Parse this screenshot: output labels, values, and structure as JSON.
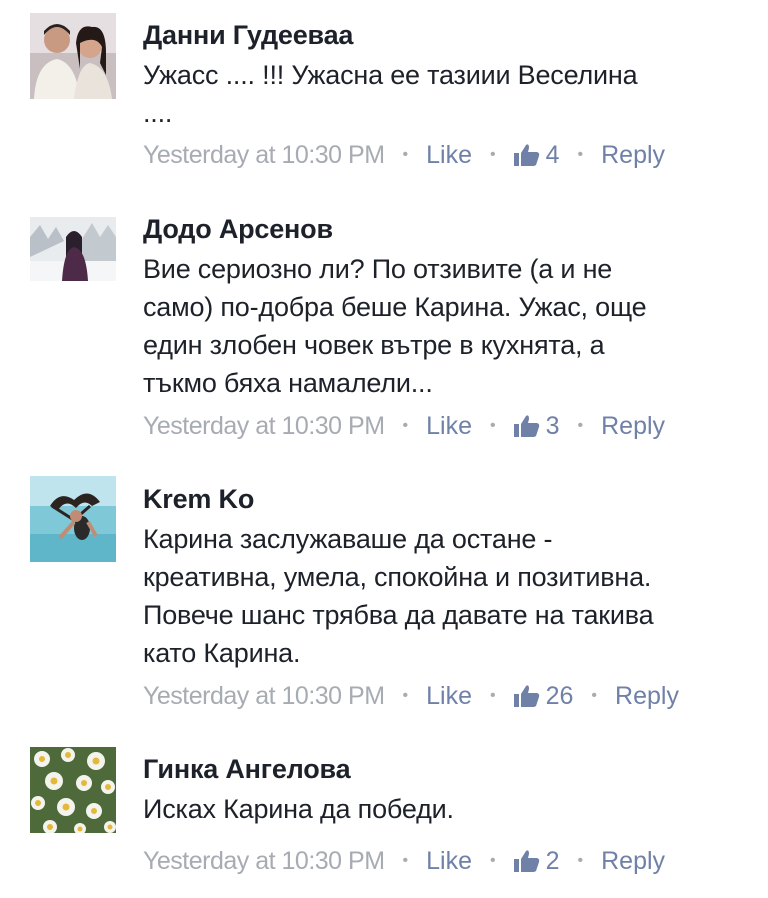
{
  "comments": [
    {
      "author": "Данни Гудееваа",
      "text": "Ужасс .... !!! Ужасна ее тазиии Веселина\n....",
      "time": "Yesterday at 10:30 PM",
      "like_label": "Like",
      "like_count": "4",
      "reply_label": "Reply",
      "avatar_icon": "couple-photo-avatar"
    },
    {
      "author": "Додо Арсенов",
      "text": "Вие сериозно ли? По отзивите (а и не\nсамо) по-добра беше Карина. Ужас, още\nедин злобен човек вътре в кухнята, а\nтъкмо бяха намалели...",
      "time": "Yesterday at 10:30 PM",
      "like_label": "Like",
      "like_count": "3",
      "reply_label": "Reply",
      "avatar_icon": "snow-portrait-avatar"
    },
    {
      "author": "Krem Ko",
      "text": "Карина заслужаваше да остане -\nкреативна, умела, спокойна и позитивна.\nПовече шанс трябва да давате на такива\nкато Карина.",
      "time": "Yesterday at 10:30 PM",
      "like_label": "Like",
      "like_count": "26",
      "reply_label": "Reply",
      "avatar_icon": "sea-hair-flip-avatar"
    },
    {
      "author": "Гинка Ангелова",
      "text": "Исках Карина да победи.",
      "time": "Yesterday at 10:30 PM",
      "like_label": "Like",
      "like_count": "2",
      "reply_label": "Reply",
      "avatar_icon": "chamomile-flowers-avatar"
    }
  ],
  "separator": "•",
  "colors": {
    "author_text": "#1d2129",
    "timestamp": "#a7abb2",
    "action_link": "#7081a8"
  }
}
